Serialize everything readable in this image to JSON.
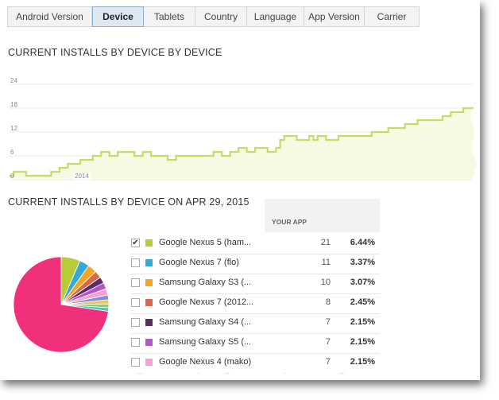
{
  "tabs": [
    {
      "label": "Android Version",
      "active": false
    },
    {
      "label": "Device",
      "active": true
    },
    {
      "label": "Tablets",
      "active": false
    },
    {
      "label": "Country",
      "active": false
    },
    {
      "label": "Language",
      "active": false
    },
    {
      "label": "App Version",
      "active": false
    },
    {
      "label": "Carrier",
      "active": false
    }
  ],
  "headings": {
    "installs_by_device": "CURRENT INSTALLS BY DEVICE BY DEVICE",
    "installs_on_date": "CURRENT INSTALLS BY DEVICE ON APR 29, 2015"
  },
  "table": {
    "column_header": "YOUR APP",
    "rows": [
      {
        "checked": true,
        "color": "#b8cc38",
        "name": "Google Nexus 5 (ham...",
        "count": "21",
        "pct": "6.44%"
      },
      {
        "checked": false,
        "color": "#35a9d6",
        "name": "Google Nexus 7 (flo)",
        "count": "11",
        "pct": "3.37%"
      },
      {
        "checked": false,
        "color": "#f4a623",
        "name": "Samsung Galaxy S3 (...",
        "count": "10",
        "pct": "3.07%"
      },
      {
        "checked": false,
        "color": "#d4694b",
        "name": "Google Nexus 7 (2012...",
        "count": "8",
        "pct": "2.45%"
      },
      {
        "checked": false,
        "color": "#5c2a6b",
        "name": "Samsung Galaxy S4 (...",
        "count": "7",
        "pct": "2.15%"
      },
      {
        "checked": false,
        "color": "#b357c6",
        "name": "Samsung Galaxy S5 (...",
        "count": "7",
        "pct": "2.15%"
      },
      {
        "checked": false,
        "color": "#f7a1d3",
        "name": "Google Nexus 4 (mako)",
        "count": "7",
        "pct": "2.15%"
      }
    ],
    "checkmark": "✔"
  },
  "chart_data": [
    {
      "type": "area",
      "yticks": [
        "0",
        "6",
        "12",
        "18",
        "24"
      ],
      "ylim": [
        0,
        24
      ],
      "x_annotation": "2014",
      "line_color": "#c9d96a",
      "fill_color": "#f7f9e3",
      "values": [
        1,
        2,
        2,
        2,
        1,
        1,
        1,
        1,
        1,
        1,
        2,
        2,
        3,
        3,
        4,
        4,
        4,
        5,
        5,
        5,
        6,
        6,
        7,
        7,
        6,
        6,
        7,
        7,
        7,
        7,
        6,
        6,
        7,
        7,
        6,
        6,
        6,
        6,
        5,
        5,
        6,
        6,
        6,
        6,
        6,
        6,
        6,
        6,
        6,
        7,
        7,
        6,
        6,
        7,
        7,
        8,
        8,
        7,
        7,
        8,
        8,
        8,
        7,
        7,
        8,
        10,
        11,
        11,
        11,
        10,
        10,
        10,
        11,
        10,
        11,
        11,
        10,
        10,
        10,
        11,
        11,
        11,
        11,
        11,
        11,
        11,
        11,
        12,
        12,
        12,
        12,
        13,
        13,
        13,
        13,
        14,
        14,
        14,
        15,
        15,
        15,
        15,
        15,
        15,
        16,
        16,
        17,
        17,
        17,
        18,
        18,
        18,
        19,
        17
      ]
    },
    {
      "type": "pie",
      "slices": [
        {
          "value": 6.44,
          "color": "#b8cc38"
        },
        {
          "value": 3.37,
          "color": "#35a9d6"
        },
        {
          "value": 3.07,
          "color": "#f4a623"
        },
        {
          "value": 2.45,
          "color": "#d4694b"
        },
        {
          "value": 2.15,
          "color": "#5c2a6b"
        },
        {
          "value": 2.15,
          "color": "#b357c6"
        },
        {
          "value": 2.15,
          "color": "#f7a1d3"
        },
        {
          "value": 1.6,
          "color": "#7b8fd4"
        },
        {
          "value": 1.4,
          "color": "#f2c14e"
        },
        {
          "value": 1.3,
          "color": "#8fcf6a"
        },
        {
          "value": 1.2,
          "color": "#4dc3c3"
        },
        {
          "value": 72.72,
          "color": "#f0307a"
        }
      ]
    }
  ]
}
